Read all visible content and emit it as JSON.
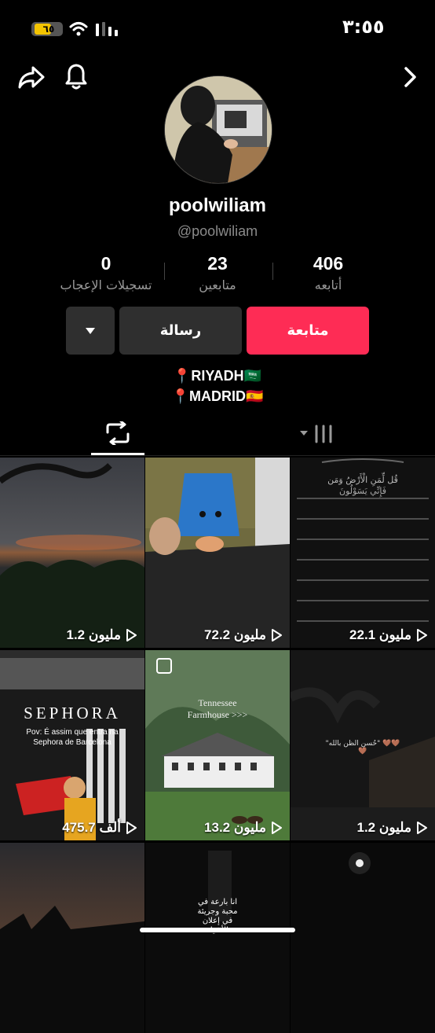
{
  "status_bar": {
    "time": "٣:٥٥",
    "battery": "٦٥",
    "battery_level": 0.65
  },
  "profile": {
    "username": "poolwiliam",
    "handle": "@poolwiliam",
    "stats": [
      {
        "value": "406",
        "label": "أتابعه"
      },
      {
        "value": "23",
        "label": "متابعين"
      },
      {
        "value": "0",
        "label": "تسجيلات الإعجاب"
      }
    ],
    "follow_label": "متابعة",
    "message_label": "رسالة",
    "bio": [
      "📍RIYADH🇸🇦",
      "📍MADRID🇪🇸"
    ]
  },
  "colors": {
    "follow_button": "#fe2c55",
    "secondary_button": "#2f2f2f",
    "background": "#000000",
    "battery": "#f4c400"
  },
  "icons": {
    "share": "share-arrow-icon",
    "notifications": "bell-icon",
    "back": "chevron-right-icon",
    "reposts_tab": "repost-icon",
    "videos_tab": "grid-bars-icon"
  },
  "grid": [
    {
      "views": "1.2 مليون"
    },
    {
      "views": "72.2 مليون"
    },
    {
      "views": "22.1 مليون"
    },
    {
      "views": "475.7 ألف",
      "caption": "Pov: É assim que entra na Sephora de Barcelona",
      "sign": "SEPHORA"
    },
    {
      "views": "13.2 مليون",
      "caption": "Tennessee Farmhouse >>>"
    },
    {
      "views": "1.2 مليون",
      "caption": "\"حُسن الظن بالله\" 🤎🤎🤎"
    },
    {
      "views": ""
    },
    {
      "views": "",
      "caption": "انا بارعة في محبة وجريئة في إعلان الأشياء"
    },
    {
      "views": ""
    }
  ],
  "grid_partial_text": {
    "quran_top": "قُل لِّمَنِ الْأَرْضُ وَمَن",
    "quran_line": "فَإِنِّي يَسَوْلُونَ"
  }
}
